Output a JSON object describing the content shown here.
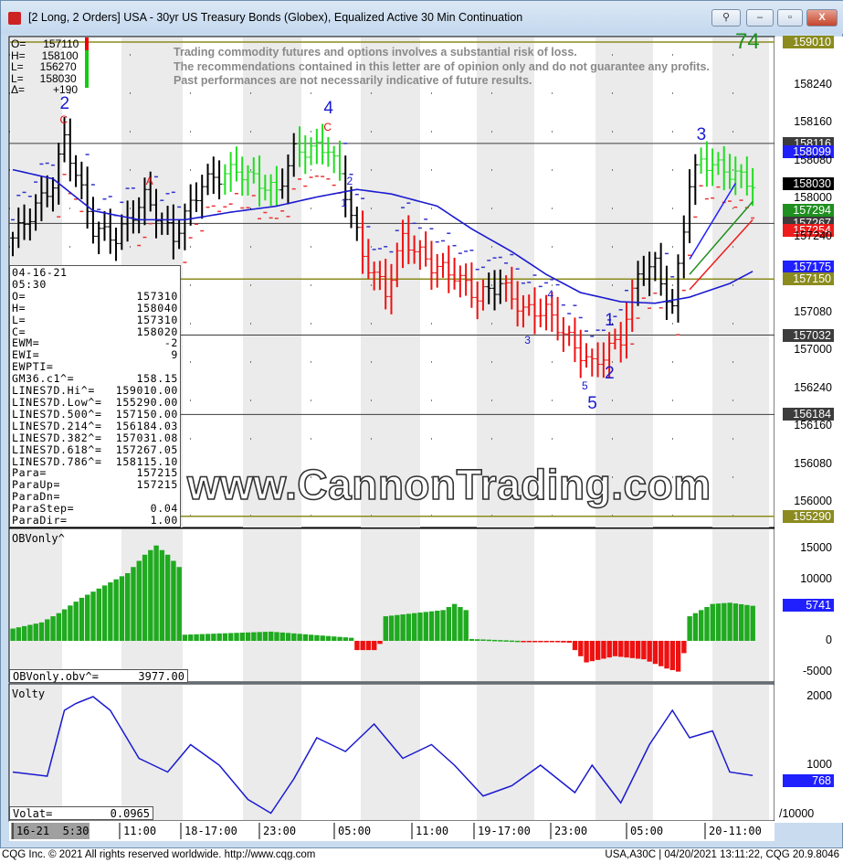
{
  "window": {
    "title": "[2 Long, 2 Orders]  USA - 30yr US Treasury Bonds (Globex), Equalized Active 30 Min Continuation",
    "buttons": {
      "link": "⚲",
      "minimize": "–",
      "maximize": "▫",
      "close": "X"
    }
  },
  "ohlc_header": [
    {
      "label": "O=",
      "value": "157110"
    },
    {
      "label": "H=",
      "value": "158100"
    },
    {
      "label": "L=",
      "value": "156270"
    },
    {
      "label": "L=",
      "value": "158030"
    },
    {
      "label": "Δ=",
      "value": "+190"
    }
  ],
  "disclaimer": [
    "Trading commodity futures and options involves a substantial risk of loss.",
    "The recommendations contained in this letter are of opinion only and do not guarantee any profits.",
    "Past performances are not necessarily indicative of future results."
  ],
  "count_label": "74",
  "watermark": "www.CannonTrading.com",
  "databox": [
    {
      "k": "04-16-21",
      "v": ""
    },
    {
      "k": "05:30",
      "v": ""
    },
    {
      "k": "O=",
      "v": "157310"
    },
    {
      "k": "H=",
      "v": "158040"
    },
    {
      "k": "L=",
      "v": "157310"
    },
    {
      "k": "C=",
      "v": "158020"
    },
    {
      "k": "EWM=",
      "v": "-2"
    },
    {
      "k": "EWI=",
      "v": "9"
    },
    {
      "k": "EWPTI=",
      "v": ""
    },
    {
      "k": "GM36.c1^=",
      "v": "158.15"
    },
    {
      "k": "LINES7D.Hi^=",
      "v": "159010.00"
    },
    {
      "k": "LINES7D.Low^=",
      "v": "155290.00"
    },
    {
      "k": "LINES7D.500^=",
      "v": "157150.00"
    },
    {
      "k": "LINES7D.214^=",
      "v": "156184.03"
    },
    {
      "k": "LINES7D.382^=",
      "v": "157031.08"
    },
    {
      "k": "LINES7D.618^=",
      "v": "157267.05"
    },
    {
      "k": "LINES7D.786^=",
      "v": "158115.10"
    },
    {
      "k": "Para=",
      "v": "157215"
    },
    {
      "k": "ParaUp=",
      "v": "157215"
    },
    {
      "k": "ParaDn=",
      "v": ""
    },
    {
      "k": "ParaStep=",
      "v": "0.04"
    },
    {
      "k": "ParaDir=",
      "v": "1.00"
    }
  ],
  "price_axis": {
    "labels": [
      {
        "t": "158240",
        "p": 158.75
      },
      {
        "t": "158160",
        "p": 158.5
      },
      {
        "t": "158080",
        "p": 158.25
      },
      {
        "t": "158000",
        "p": 158.0
      },
      {
        "t": "157240",
        "p": 157.75
      },
      {
        "t": "157080",
        "p": 157.25
      },
      {
        "t": "157000",
        "p": 157.0
      },
      {
        "t": "156240",
        "p": 156.75
      },
      {
        "t": "156160",
        "p": 156.5
      },
      {
        "t": "156080",
        "p": 156.25
      },
      {
        "t": "156000",
        "p": 156.0
      }
    ],
    "badges": [
      {
        "t": "159010",
        "p": 159.031,
        "bg": "#8b8b1f",
        "fg": "#fff",
        "line": true
      },
      {
        "t": "158116",
        "p": 158.363,
        "bg": "#3c3c3c",
        "fg": "#fff",
        "line": true
      },
      {
        "t": "158099",
        "p": 158.31,
        "bg": "#2020ff",
        "fg": "#fff"
      },
      {
        "t": "158030",
        "p": 158.1,
        "bg": "#000",
        "fg": "#fff"
      },
      {
        "t": "157294",
        "p": 157.92,
        "bg": "#1f8f1f",
        "fg": "#fff"
      },
      {
        "t": "157267",
        "p": 157.836,
        "bg": "#3c3c3c",
        "fg": "#fff",
        "line": true
      },
      {
        "t": "157254",
        "p": 157.79,
        "bg": "#ee1c1c",
        "fg": "#fff"
      },
      {
        "t": "157175",
        "p": 157.55,
        "bg": "#2020ff",
        "fg": "#fff"
      },
      {
        "t": "157150",
        "p": 157.469,
        "bg": "#8b8b1f",
        "fg": "#fff",
        "line": true
      },
      {
        "t": "157032",
        "p": 157.1,
        "bg": "#3c3c3c",
        "fg": "#fff",
        "line": true
      },
      {
        "t": "156184",
        "p": 156.577,
        "bg": "#3c3c3c",
        "fg": "#fff",
        "line": true
      },
      {
        "t": "155290",
        "p": 155.906,
        "bg": "#8b8b1f",
        "fg": "#fff",
        "line": true
      }
    ]
  },
  "wave_labels": [
    {
      "t": "2",
      "c": "b",
      "bar": 9,
      "p": 158.63
    },
    {
      "t": "C",
      "c": "r",
      "bar": 9,
      "p": 158.5
    },
    {
      "t": "A",
      "c": "r",
      "bar": 24,
      "p": 158.1
    },
    {
      "t": "4",
      "c": "b",
      "bar": 55,
      "p": 158.6
    },
    {
      "t": "C",
      "c": "r",
      "bar": 55,
      "p": 158.45
    },
    {
      "t": "2",
      "c": "s",
      "bar": 59,
      "p": 158.1
    },
    {
      "t": "1",
      "c": "s",
      "bar": 58,
      "p": 157.95
    },
    {
      "t": "3",
      "c": "s",
      "bar": 90,
      "p": 157.05
    },
    {
      "t": "4",
      "c": "s",
      "bar": 94,
      "p": 157.35
    },
    {
      "t": "5",
      "c": "s",
      "bar": 100,
      "p": 156.75
    },
    {
      "t": "1",
      "c": "b",
      "bar": 104,
      "p": 157.2
    },
    {
      "t": "2",
      "c": "b",
      "bar": 104,
      "p": 156.85
    },
    {
      "t": "5",
      "c": "b",
      "bar": 101,
      "p": 156.65
    },
    {
      "t": "3",
      "c": "b",
      "bar": 120,
      "p": 158.42
    }
  ],
  "time_axis": [
    "16-21  5:30",
    "11:00",
    "18-17:00",
    "23:00",
    "05:00",
    "11:00",
    "19-17:00",
    "23:00",
    "05:00",
    "20-11:00"
  ],
  "obv_panel": {
    "title": "OBVonly^",
    "readout_label": "OBVonly.obv^=",
    "readout_value": "3977.00",
    "axis": [
      {
        "t": "15000",
        "v": 15000
      },
      {
        "t": "10000",
        "v": 10000
      },
      {
        "t": "0",
        "v": 0
      },
      {
        "t": "-5000",
        "v": -5000
      }
    ],
    "badge": {
      "t": "5741",
      "v": 5741,
      "bg": "#2020ff"
    }
  },
  "volty_panel": {
    "title": "Volty",
    "readout_label": "Volat=",
    "readout_value": "0.0965",
    "axis": [
      {
        "t": "2000",
        "v": 2000
      },
      {
        "t": "1000",
        "v": 1000
      }
    ],
    "scale_label": "/10000",
    "badge": {
      "t": "768",
      "v": 768,
      "bg": "#2020ff"
    }
  },
  "footer": {
    "left": "CQG Inc. © 2021 All rights reserved worldwide. http://www.cqg.com",
    "right": "USA,A30C | 04/20/2021 13:11:22, CQG 20.9.8046"
  },
  "chart_data": {
    "type": "ohlc",
    "bars": 130,
    "close_keypoints": [
      [
        0,
        157.74
      ],
      [
        7,
        158.1
      ],
      [
        9,
        158.4
      ],
      [
        14,
        157.8
      ],
      [
        18,
        157.74
      ],
      [
        23,
        158.01
      ],
      [
        28,
        157.74
      ],
      [
        33,
        158.1
      ],
      [
        39,
        158.19
      ],
      [
        46,
        158.04
      ],
      [
        49,
        158.31
      ],
      [
        55,
        158.34
      ],
      [
        58,
        158.04
      ],
      [
        61,
        157.62
      ],
      [
        65,
        157.38
      ],
      [
        68,
        157.74
      ],
      [
        73,
        157.56
      ],
      [
        77,
        157.5
      ],
      [
        81,
        157.35
      ],
      [
        85,
        157.44
      ],
      [
        89,
        157.26
      ],
      [
        93,
        157.26
      ],
      [
        98,
        157.02
      ],
      [
        101,
        156.9
      ],
      [
        106,
        157.08
      ],
      [
        109,
        157.5
      ],
      [
        112,
        157.56
      ],
      [
        115,
        157.26
      ],
      [
        118,
        158.1
      ],
      [
        120,
        158.25
      ],
      [
        124,
        158.19
      ],
      [
        129,
        158.1
      ]
    ],
    "color_segments": [
      {
        "from": 37,
        "to": 46,
        "color": "#22dd22"
      },
      {
        "from": 50,
        "to": 57,
        "color": "#22dd22"
      },
      {
        "from": 61,
        "to": 82,
        "color": "#ee1111"
      },
      {
        "from": 86,
        "to": 108,
        "color": "#ee1111"
      },
      {
        "from": 120,
        "to": 129,
        "color": "#22dd22"
      }
    ],
    "ma_keypoints": [
      [
        0,
        158.19
      ],
      [
        7,
        158.13
      ],
      [
        14,
        157.92
      ],
      [
        22,
        157.86
      ],
      [
        30,
        157.86
      ],
      [
        38,
        157.91
      ],
      [
        46,
        157.95
      ],
      [
        53,
        158.01
      ],
      [
        60,
        158.06
      ],
      [
        66,
        158.03
      ],
      [
        74,
        157.95
      ],
      [
        80,
        157.8
      ],
      [
        87,
        157.65
      ],
      [
        93,
        157.5
      ],
      [
        99,
        157.38
      ],
      [
        106,
        157.32
      ],
      [
        112,
        157.31
      ],
      [
        118,
        157.35
      ],
      [
        125,
        157.44
      ],
      [
        129,
        157.52
      ]
    ],
    "fast_lines": [
      {
        "color": "#1f8f1f",
        "pts": [
          [
            118,
            157.5
          ],
          [
            129,
            157.98
          ]
        ]
      },
      {
        "color": "#ee1c1c",
        "pts": [
          [
            118,
            157.4
          ],
          [
            129,
            157.86
          ]
        ]
      },
      {
        "color": "#2020ff",
        "pts": [
          [
            118,
            157.6
          ],
          [
            126,
            158.1
          ]
        ]
      }
    ],
    "obv_keypoints": [
      [
        0,
        2000
      ],
      [
        5,
        3000
      ],
      [
        8,
        4500
      ],
      [
        12,
        7000
      ],
      [
        16,
        9000
      ],
      [
        20,
        11000
      ],
      [
        23,
        14000
      ],
      [
        25,
        15500
      ],
      [
        27,
        14000
      ],
      [
        29,
        12000
      ],
      [
        30,
        1000
      ],
      [
        45,
        1500
      ],
      [
        59,
        500
      ],
      [
        60,
        -1500
      ],
      [
        63,
        -1500
      ],
      [
        64,
        -500
      ],
      [
        65,
        4000
      ],
      [
        70,
        4500
      ],
      [
        75,
        5000
      ],
      [
        77,
        6000
      ],
      [
        79,
        5000
      ],
      [
        80,
        300
      ],
      [
        97,
        -300
      ],
      [
        98,
        -1500
      ],
      [
        100,
        -3500
      ],
      [
        105,
        -2500
      ],
      [
        110,
        -3000
      ],
      [
        114,
        -4500
      ],
      [
        116,
        -5000
      ],
      [
        117,
        -2000
      ],
      [
        118,
        4000
      ],
      [
        122,
        6000
      ],
      [
        125,
        6200
      ],
      [
        129,
        5700
      ]
    ],
    "volty_keypoints": [
      [
        0,
        900
      ],
      [
        6,
        840
      ],
      [
        9,
        1800
      ],
      [
        11,
        1900
      ],
      [
        14,
        2000
      ],
      [
        17,
        1800
      ],
      [
        22,
        1100
      ],
      [
        27,
        900
      ],
      [
        31,
        1300
      ],
      [
        36,
        1000
      ],
      [
        41,
        500
      ],
      [
        45,
        300
      ],
      [
        49,
        800
      ],
      [
        53,
        1400
      ],
      [
        58,
        1200
      ],
      [
        63,
        1600
      ],
      [
        68,
        1100
      ],
      [
        73,
        1300
      ],
      [
        77,
        1000
      ],
      [
        82,
        550
      ],
      [
        87,
        700
      ],
      [
        92,
        1000
      ],
      [
        98,
        600
      ],
      [
        101,
        1000
      ],
      [
        106,
        450
      ],
      [
        111,
        1300
      ],
      [
        115,
        1800
      ],
      [
        118,
        1400
      ],
      [
        122,
        1500
      ],
      [
        125,
        900
      ],
      [
        129,
        850
      ]
    ]
  }
}
